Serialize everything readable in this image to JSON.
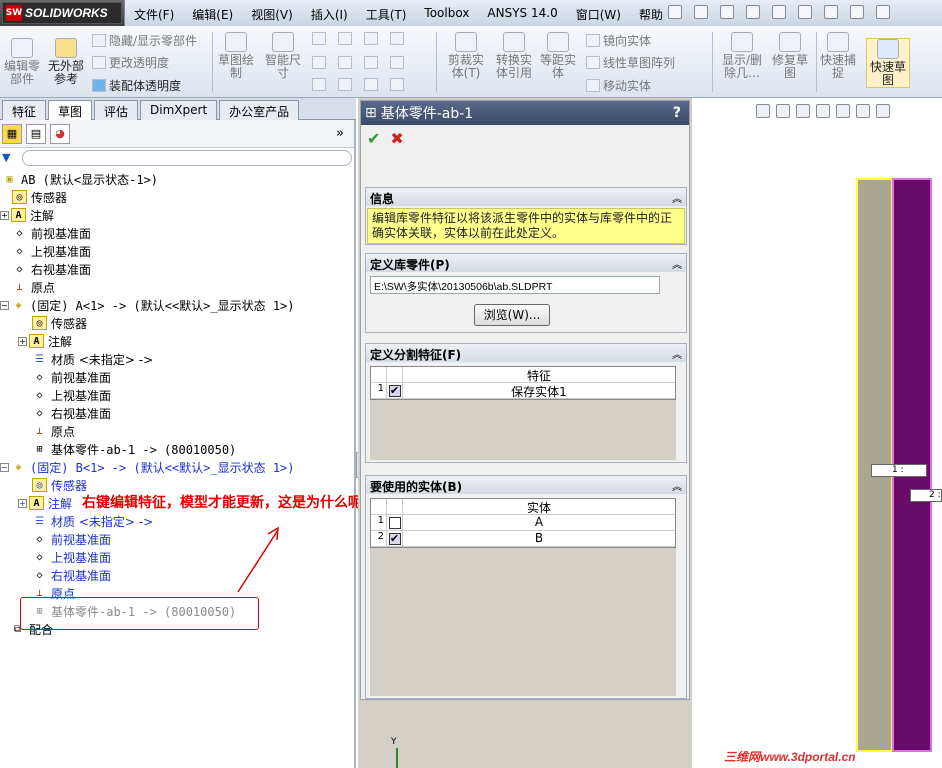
{
  "app": {
    "logo_text": "SOLIDWORKS",
    "logo_badge": "SW"
  },
  "menu": [
    "文件(F)",
    "编辑(E)",
    "视图(V)",
    "插入(I)",
    "工具(T)",
    "Toolbox",
    "ANSYS 14.0",
    "窗口(W)",
    "帮助(H)"
  ],
  "ribbon": {
    "edit_part": "编辑零部件",
    "external_ref": "无外部参考",
    "hide_show": "隐藏/显示零部件",
    "change_transparency": "更改透明度",
    "assembly_transparency": "装配体透明度",
    "sketch": "草图绘制",
    "smart_dim": "智能尺寸",
    "trim": "剪裁实体(T)",
    "convert": "转换实体引用",
    "offset": "等距实体",
    "mirror": "镜向实体",
    "linear_pattern": "线性草图阵列",
    "move": "移动实体",
    "display_delete": "显示/删除几…",
    "repair": "修复草图",
    "quick_snap": "快速捕捉",
    "rapid_sketch": "快速草图"
  },
  "tabs": [
    "特征",
    "草图",
    "评估",
    "DimXpert",
    "办公室产品"
  ],
  "tree": {
    "root": "AB  (默认<显示状态-1>)",
    "sensor": "传感器",
    "annotation": "注解",
    "front_plane": "前视基准面",
    "top_plane": "上视基准面",
    "right_plane": "右视基准面",
    "origin": "原点",
    "part_a": "(固定) A<1> -> (默认<<默认>_显示状态 1>)",
    "material": "材质 <未指定> ->",
    "base_part": "基体零件-ab-1 -> (80010050)",
    "part_b": "(固定) B<1> -> (默认<<默认>_显示状态 1>)",
    "mates": "配合"
  },
  "annotation_note": "右键编辑特征，模型才能更新，这是为什么呢？！",
  "property_manager": {
    "title": "基体零件-ab-1",
    "help": "?",
    "info_header": "信息",
    "info_text": "编辑库零件特征以将该派生零件中的实体与库零件中的正确实体关联，实体以前在此处定义。",
    "lib_header": "定义库零件(P)",
    "lib_path": "E:\\SW\\多实体\\20130506b\\ab.SLDPRT",
    "browse_label": "浏览(W)...",
    "split_header": "定义分割特征(F)",
    "split_col": "特征",
    "split_rows": [
      {
        "idx": "1",
        "checked": true,
        "name": "保存实体1"
      }
    ],
    "bodies_header": "要使用的实体(B)",
    "bodies_col": "实体",
    "bodies_rows": [
      {
        "idx": "1",
        "checked": false,
        "name": "A"
      },
      {
        "idx": "2",
        "checked": true,
        "name": "B"
      }
    ]
  },
  "graphics": {
    "label1": "1 :",
    "label2": "2 :",
    "axis_y": "Y",
    "colors": {
      "body1": "#a9a78f",
      "body2": "#6a0a6a",
      "highlight": "#ffff3a"
    }
  },
  "watermark": "三维网www.3dportal.cn"
}
